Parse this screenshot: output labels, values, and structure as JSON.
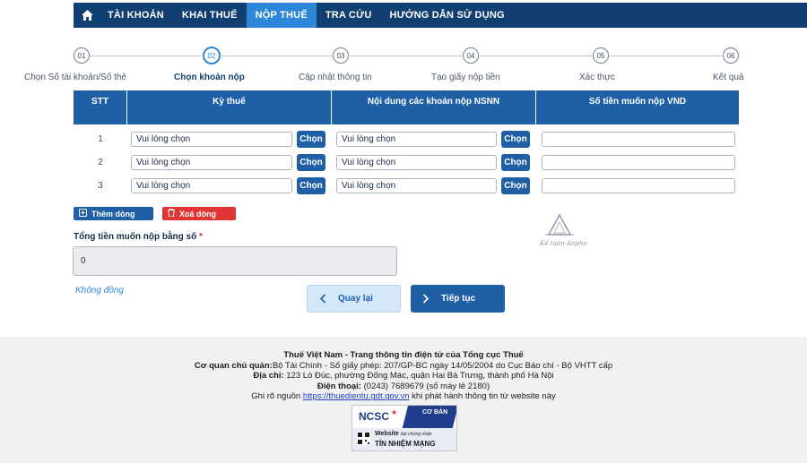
{
  "nav": {
    "items": [
      {
        "label": "TÀI KHOẢN"
      },
      {
        "label": "KHAI THUẾ"
      },
      {
        "label": "NỘP THUẾ",
        "active": true
      },
      {
        "label": "TRA CỨU"
      },
      {
        "label": "HƯỚNG DẪN SỬ DỤNG"
      }
    ]
  },
  "steps": [
    {
      "num": "01",
      "label": "Chọn Số tài khoản/Số thẻ"
    },
    {
      "num": "02",
      "label": "Chọn khoản nộp",
      "active": true
    },
    {
      "num": "03",
      "label": "Cập nhật thông tin"
    },
    {
      "num": "04",
      "label": "Tạo giấy nộp tiền"
    },
    {
      "num": "05",
      "label": "Xác thực"
    },
    {
      "num": "06",
      "label": "Kết quả"
    }
  ],
  "table": {
    "headers": [
      "STT",
      "Kỳ thuế",
      "Nội dung các khoản nộp NSNN",
      "Số tiền muốn nộp VND"
    ],
    "rows": [
      {
        "stt": "1",
        "ky_thue": "Vui lòng chọn",
        "noi_dung": "Vui lòng chọn",
        "so_tien": ""
      },
      {
        "stt": "2",
        "ky_thue": "Vui lòng chọn",
        "noi_dung": "Vui lòng chọn",
        "so_tien": ""
      },
      {
        "stt": "3",
        "ky_thue": "Vui lòng chọn",
        "noi_dung": "Vui lòng chọn",
        "so_tien": ""
      }
    ],
    "choose_label": "Chọn"
  },
  "actions": {
    "add_row": "Thêm dòng",
    "delete_row": "Xoá dòng"
  },
  "total": {
    "label": "Tổng tiền muốn nộp bằng số",
    "required_mark": "*",
    "value": "0",
    "in_words": "Không đồng"
  },
  "nav_buttons": {
    "back": "Quay lại",
    "next": "Tiếp tục"
  },
  "footer": {
    "site_title": "Thuế Việt Nam - Trang thông tin điện tử của Tổng cục Thuế",
    "agency_label": "Cơ quan chủ quản:",
    "agency_value": "Bộ Tài Chính - Số giấy phép: 207/GP-BC ngày 14/05/2004 do Cục Báo chí - Bộ VHTT cấp",
    "address_label": "Địa chỉ:",
    "address_value": "123 Lò Đúc, phường Đống Mác, quận Hai Bà Trưng, thành phố Hà Nội",
    "phone_label": "Điện thoại:",
    "phone_value": "(0243) 7689679 (số máy lẻ 2180)",
    "source_prefix": "Ghi rõ nguồn",
    "source_link": "https://thuedientu.gdt.gov.vn",
    "source_suffix": "khi phát hành thông tin từ website này"
  },
  "badge": {
    "org": "NCSC",
    "level": "CƠ BẢN",
    "line1": "Website",
    "line1_small": "đạt chứng nhận",
    "line2": "TÍN NHIỆM MẠNG"
  },
  "watermark": {
    "text": "Kế toán Anpha"
  },
  "colors": {
    "primary": "#1f5fa6",
    "nav": "#123f72",
    "active_tab": "#2d86d8",
    "danger": "#e03535"
  }
}
